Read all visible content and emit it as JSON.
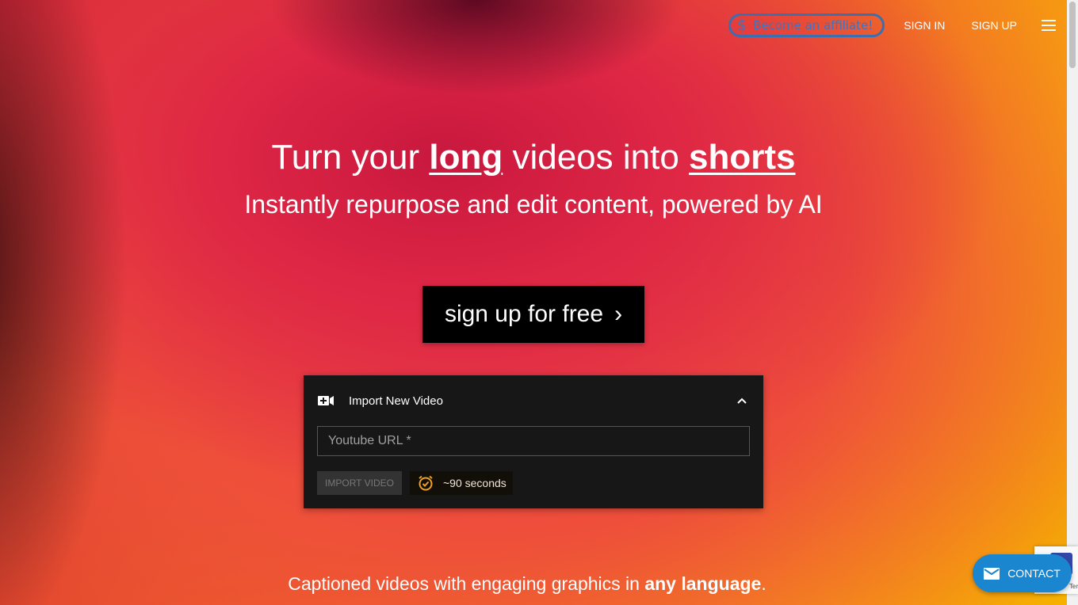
{
  "nav": {
    "affiliate_label": "Become an affiliate!",
    "sign_in": "SIGN IN",
    "sign_up": "SIGN UP",
    "affiliate_color": "#3a6fb0"
  },
  "hero": {
    "title_part1": "Turn your ",
    "title_em1": "long",
    "title_part2": " videos into ",
    "title_em2": "shorts",
    "subtitle": "Instantly repurpose and edit content, powered by AI",
    "cta_label": "sign up for free"
  },
  "import_card": {
    "title": "Import New Video",
    "url_placeholder": "Youtube URL *",
    "url_value": "",
    "import_button": "IMPORT VIDEO",
    "time_estimate": "~90 seconds"
  },
  "footer_text": {
    "part1": "Captioned videos with engaging graphics in ",
    "em": "any language",
    "part2": "."
  },
  "contact": {
    "label": "CONTACT",
    "color": "#1a86d0"
  },
  "recaptcha": {
    "text": "Ter"
  }
}
